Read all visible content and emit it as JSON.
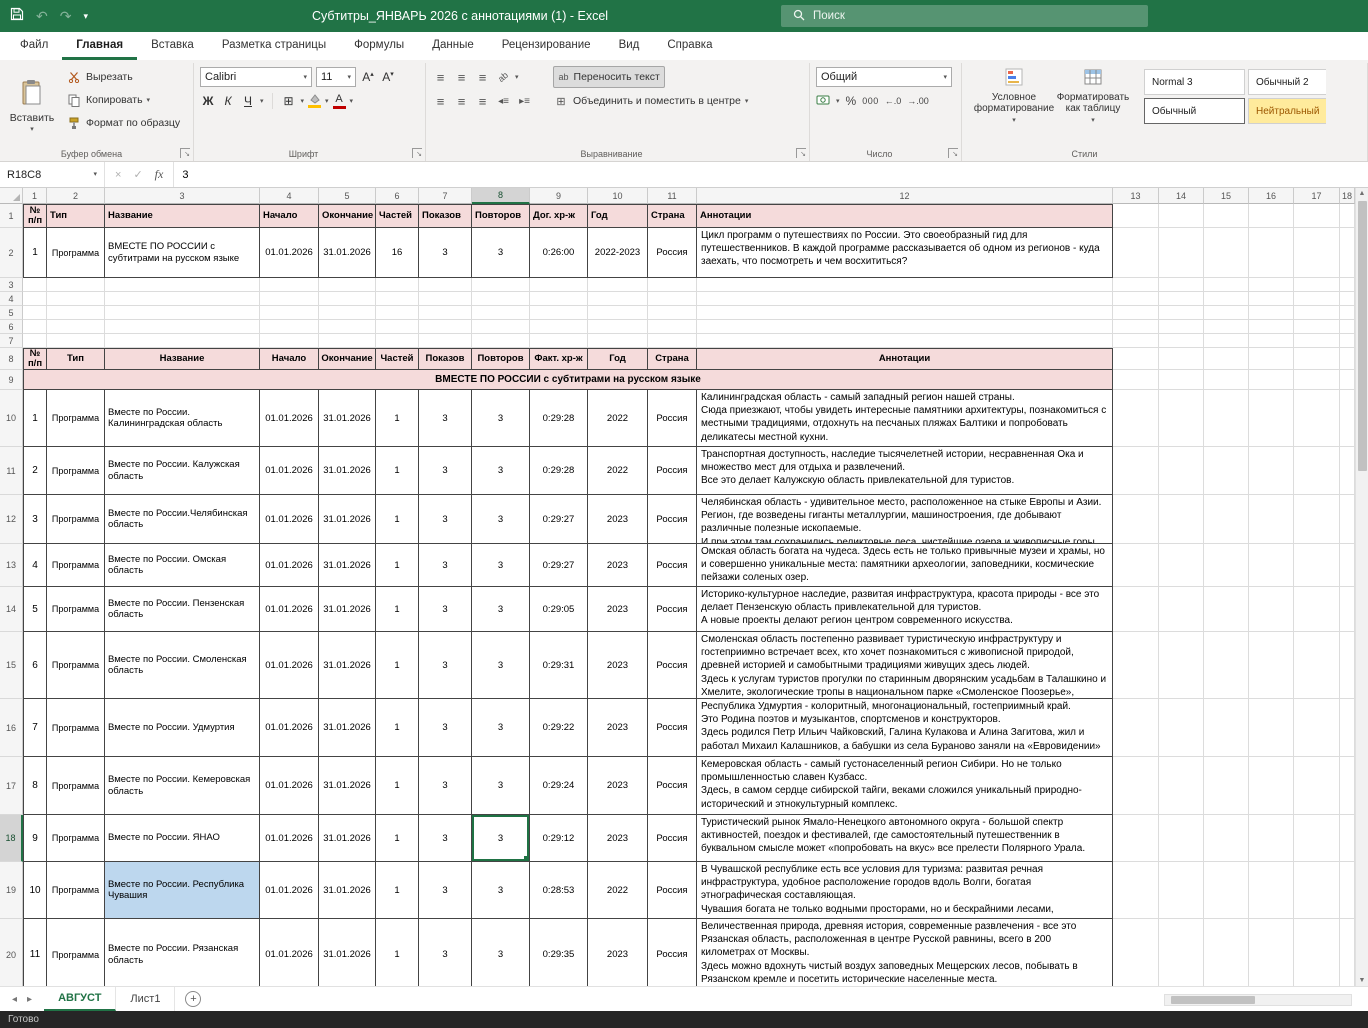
{
  "titlebar": {
    "title": "Субтитры_ЯНВАРЬ 2026 с аннотациями (1)  -  Excel",
    "search_placeholder": "Поиск"
  },
  "menu": {
    "tabs": [
      "Файл",
      "Главная",
      "Вставка",
      "Разметка страницы",
      "Формулы",
      "Данные",
      "Рецензирование",
      "Вид",
      "Справка"
    ],
    "active_tab": "Главная"
  },
  "ribbon": {
    "clipboard": {
      "paste": "Вставить",
      "cut": "Вырезать",
      "copy": "Копировать",
      "format_painter": "Формат по образцу",
      "group_label": "Буфер обмена"
    },
    "font": {
      "font_name": "Calibri",
      "font_size": "11",
      "bold": "Ж",
      "italic": "К",
      "underline": "Ч",
      "group_label": "Шрифт"
    },
    "alignment": {
      "wrap_text": "Переносить текст",
      "merge_center": "Объединить и поместить в центре",
      "group_label": "Выравнивание"
    },
    "number": {
      "format": "Общий",
      "percent": "%",
      "thousands": "000",
      "group_label": "Число"
    },
    "styles": {
      "conditional": "Условное форматирование",
      "format_table": "Форматировать как таблицу",
      "gallery": [
        "Normal 3",
        "Обычный 2",
        "Обычный",
        "Нейтральный"
      ],
      "selected_style": "Обычный",
      "group_label": "Стили"
    }
  },
  "formula_bar": {
    "name_box": "R18C8",
    "fx": "fx",
    "value": "3"
  },
  "grid": {
    "column_headers": [
      "1",
      "2",
      "3",
      "4",
      "5",
      "6",
      "7",
      "8",
      "9",
      "10",
      "11",
      "12",
      "13",
      "14",
      "15",
      "16",
      "17",
      "18"
    ],
    "selected_column": "8",
    "selected_row": "18",
    "selected_cell_ref": "R18C8"
  },
  "table1": {
    "headers": [
      "№ п/п",
      "Тип",
      "Название",
      "Начало",
      "Окончание",
      "Частей",
      "Показов",
      "Повторов",
      "Дог. хр-ж",
      "Год",
      "Страна",
      "Аннотации"
    ],
    "rows": [
      {
        "num": "1",
        "type": "Программа",
        "title": "ВМЕСТЕ ПО РОССИИ с субтитрами на русском языке",
        "start": "01.01.2026",
        "end": "31.01.2026",
        "parts": "16",
        "shows": "3",
        "repeats": "3",
        "duration": "0:26:00",
        "year": "2022-2023",
        "country": "Россия",
        "annotation": "Цикл программ о путешествиях по России. Это своеобразный гид для путешественников. В каждой программе рассказывается об одном из регионов - куда заехать, что посмотреть и чем восхититься?"
      }
    ]
  },
  "table2": {
    "headers": [
      "№ п/п",
      "Тип",
      "Название",
      "Начало",
      "Окончание",
      "Частей",
      "Показов",
      "Повторов",
      "Факт. хр-ж",
      "Год",
      "Страна",
      "Аннотации"
    ],
    "section_title": "ВМЕСТЕ ПО РОССИИ с субтитрами на русском языке",
    "rows": [
      {
        "num": "1",
        "type": "Программа",
        "title": "Вместе по России. Калининградская область",
        "start": "01.01.2026",
        "end": "31.01.2026",
        "parts": "1",
        "shows": "3",
        "repeats": "3",
        "duration": "0:29:28",
        "year": "2022",
        "country": "Россия",
        "annotation": "Калининградская область - самый западный регион нашей страны.\nСюда приезжают, чтобы увидеть интересные памятники архитектуры, познакомиться с местными традициями, отдохнуть на песчаных пляжах Балтики и попробовать деликатесы местной кухни."
      },
      {
        "num": "2",
        "type": "Программа",
        "title": "Вместе по России. Калужская область",
        "start": "01.01.2026",
        "end": "31.01.2026",
        "parts": "1",
        "shows": "3",
        "repeats": "3",
        "duration": "0:29:28",
        "year": "2022",
        "country": "Россия",
        "annotation": "Транспортная доступность, наследие тысячелетней истории, несравненная Ока и множество мест для отдыха и развлечений.\nВсе это делает Калужскую область привлекательной для туристов."
      },
      {
        "num": "3",
        "type": "Программа",
        "title": "Вместе по России.Челябинская область",
        "start": "01.01.2026",
        "end": "31.01.2026",
        "parts": "1",
        "shows": "3",
        "repeats": "3",
        "duration": "0:29:27",
        "year": "2023",
        "country": "Россия",
        "annotation": "Челябинская область - удивительное место, расположенное на стыке Европы и Азии.\nРегион, где возведены гиганты металлургии, машиностроения, где добывают различные полезные ископаемые.\nИ при этом там сохранились реликтовые леса, чистейшие озера и живописные горы."
      },
      {
        "num": "4",
        "type": "Программа",
        "title": "Вместе по России. Омская область",
        "start": "01.01.2026",
        "end": "31.01.2026",
        "parts": "1",
        "shows": "3",
        "repeats": "3",
        "duration": "0:29:27",
        "year": "2023",
        "country": "Россия",
        "annotation": "Омская область богата на чудеса. Здесь есть не только привычные музеи и храмы, но и совершенно уникальные места: памятники археологии, заповедники, космические пейзажи соленых озер."
      },
      {
        "num": "5",
        "type": "Программа",
        "title": "Вместе по России. Пензенская область",
        "start": "01.01.2026",
        "end": "31.01.2026",
        "parts": "1",
        "shows": "3",
        "repeats": "3",
        "duration": "0:29:05",
        "year": "2023",
        "country": "Россия",
        "annotation": "Историко-культурное наследие, развитая инфраструктура, красота природы - все это делает Пензенскую область привлекательной для туристов.\nА новые проекты делают регион центром современного искусства."
      },
      {
        "num": "6",
        "type": "Программа",
        "title": "Вместе по России. Смоленская область",
        "start": "01.01.2026",
        "end": "31.01.2026",
        "parts": "1",
        "shows": "3",
        "repeats": "3",
        "duration": "0:29:31",
        "year": "2023",
        "country": "Россия",
        "annotation": "Смоленская область постепенно развивает туристическую инфраструктуру и гостеприимно встречает всех, кто хочет познакомиться с живописной природой, древней историей и самобытными традициями живущих здесь людей.\nЗдесь к услугам туристов прогулки по старинным дворянским усадьбам в Талашкино и Хмелите, экологические тропы в национальном парке «Смоленское Поозерье», Гнездовские курганы с"
      },
      {
        "num": "7",
        "type": "Программа",
        "title": "Вместе по России. Удмуртия",
        "start": "01.01.2026",
        "end": "31.01.2026",
        "parts": "1",
        "shows": "3",
        "repeats": "3",
        "duration": "0:29:22",
        "year": "2023",
        "country": "Россия",
        "annotation": "Республика Удмуртия - колоритный, многонациональный, гостеприимный край.\nЭто Родина поэтов и музыкантов, спортсменов и конструкторов.\nЗдесь родился Петр Ильич Чайковский, Галина Кулакова и Алина Загитова, жил и работал Михаил Калашников, а бабушки из села Бураново заняли на «Евровидении» второе место."
      },
      {
        "num": "8",
        "type": "Программа",
        "title": "Вместе по России. Кемеровская область",
        "start": "01.01.2026",
        "end": "31.01.2026",
        "parts": "1",
        "shows": "3",
        "repeats": "3",
        "duration": "0:29:24",
        "year": "2023",
        "country": "Россия",
        "annotation": "Кемеровская область - самый густонаселенный регион Сибири. Но не только промышленностью славен Кузбасс.\nЗдесь, в самом сердце сибирской тайги, веками сложился уникальный природно-исторический и этнокультурный комплекс."
      },
      {
        "num": "9",
        "type": "Программа",
        "title": "Вместе по России. ЯНАО",
        "start": "01.01.2026",
        "end": "31.01.2026",
        "parts": "1",
        "shows": "3",
        "repeats": "3",
        "duration": "0:29:12",
        "year": "2023",
        "country": "Россия",
        "annotation": "Туристический рынок Ямало-Ненецкого автономного округа - большой спектр активностей, поездок и фестивалей, где самостоятельный путешественник в буквальном смысле может «попробовать на вкус» все прелести Полярного Урала."
      },
      {
        "num": "10",
        "type": "Программа",
        "title": "Вместе по России. Республика Чувашия",
        "start": "01.01.2026",
        "end": "31.01.2026",
        "parts": "1",
        "shows": "3",
        "repeats": "3",
        "duration": "0:28:53",
        "year": "2022",
        "country": "Россия",
        "annotation": "В Чувашской республике есть все условия для туризма: развитая речная инфраструктура, удобное расположение городов вдоль Волги, богатая этнографическая составляющая.\nЧувашия богата не только водными просторами, но и бескрайними лесами, живописными лугами, а самое главное – своими жителями."
      },
      {
        "num": "11",
        "type": "Программа",
        "title": "Вместе по России. Рязанская область",
        "start": "01.01.2026",
        "end": "31.01.2026",
        "parts": "1",
        "shows": "3",
        "repeats": "3",
        "duration": "0:29:35",
        "year": "2023",
        "country": "Россия",
        "annotation": "Величественная природа, древняя история, современные развлечения - все это Рязанская область, расположенная в центре Русской равнины, всего в 200 километрах от Москвы.\nЗдесь можно вдохнуть чистый воздух заповедных Мещерских лесов, побывать в Рязанском кремле и посетить исторические населенные места."
      }
    ]
  },
  "sheet_bar": {
    "tabs": [
      "АВГУСТ",
      "Лист1"
    ],
    "active_tab": "АВГУСТ",
    "add_label": "+"
  },
  "status_bar": {
    "text": "Готово"
  }
}
